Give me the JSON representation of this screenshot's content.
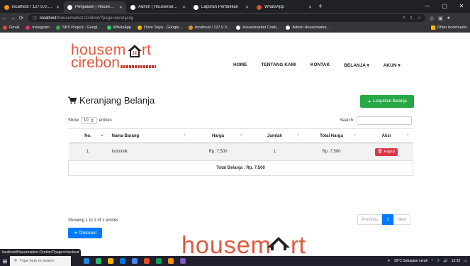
{
  "browser": {
    "tabs": [
      {
        "title": "localhost / 127.0.0.1 / buhan",
        "favicon_color": "#f29111",
        "active": false
      },
      {
        "title": "Penjualan | Housemarket Cire",
        "favicon_color": "#ffffff",
        "active": true
      },
      {
        "title": "Admin | Housemarket Cirebo",
        "favicon_color": "#ffffff",
        "active": false
      },
      {
        "title": "Laporan Pembelian",
        "favicon_color": "#ffffff",
        "active": false
      },
      {
        "title": "WhatsApp",
        "favicon_color": "#e0493b",
        "active": false
      }
    ],
    "new_tab": "+",
    "window_controls": {
      "minimize": "—",
      "maximize": "▢",
      "close": "✕"
    },
    "url_host": "localhost",
    "url_path": "/Housemarket-Cirebon/?page=keranjang",
    "bookmarks": [
      {
        "label": "Gmail",
        "color": "#ea4335"
      },
      {
        "label": "Instagram",
        "color": "#e1306c"
      },
      {
        "label": "SKS Project - Googl...",
        "color": "#34a853"
      },
      {
        "label": "WhatsApp",
        "color": "#25d366"
      },
      {
        "label": "Drive Saya - Google...",
        "color": "#fbbc04"
      },
      {
        "label": "localhost / 127.0.0...",
        "color": "#f29111"
      },
      {
        "label": "Housemarket Cireb...",
        "color": "#ffffff"
      },
      {
        "label": "Admin Housemarke...",
        "color": "#ffffff"
      }
    ],
    "bookmarks_other": "Other bookmarks",
    "status_url": "localhost/Housemarket-Cirebon/?page=checkout"
  },
  "site": {
    "logo": {
      "part1": "housem",
      "part2": "rt",
      "part3": "cirebon",
      "house_letter": "H"
    },
    "nav": {
      "home": "HOME",
      "about": "TENTANG KAMI",
      "contact": "KONTAK",
      "shop": "BELANJA",
      "account": "AKUN"
    }
  },
  "cart": {
    "title": "Keranjang Belanja",
    "continue_label": "Lanjutkan Belanja",
    "show_label": "Show",
    "entries_value": "10",
    "entries_label": "entries",
    "search_label": "Search:",
    "columns": {
      "no": "No.",
      "name": "Nama Barang",
      "price": "Harga",
      "qty": "Jumlah",
      "total": "Total Harga",
      "action": "Aksi"
    },
    "rows": [
      {
        "no": "1.",
        "name": "Indomilk",
        "price": "Rp. 7.500",
        "qty": "1",
        "total": "Rp. 7.500",
        "action": "Hapus"
      }
    ],
    "grand_total": "Total Belanja : Rp. 7,500",
    "info": "Showing 1 to 1 of 1 entries",
    "checkout_label": "Checkout",
    "pager": {
      "previous": "Previous",
      "current": "1",
      "next": "Next"
    }
  },
  "footer": {
    "logo_text": "housem"
  },
  "taskbar": {
    "search_placeholder": "Type here to search",
    "weather": "30°C  Sebagian cerah",
    "time": "13:25",
    "app_colors": [
      "#1e88e5",
      "#2bb673",
      "#f4b400",
      "#0078d4",
      "#4285f4",
      "#e44d26",
      "#0f9d58",
      "#f29111",
      "#7e57c2"
    ]
  },
  "colors": {
    "brand": "#e3573e",
    "success": "#28a745",
    "primary": "#007bff",
    "danger": "#dc3545"
  }
}
